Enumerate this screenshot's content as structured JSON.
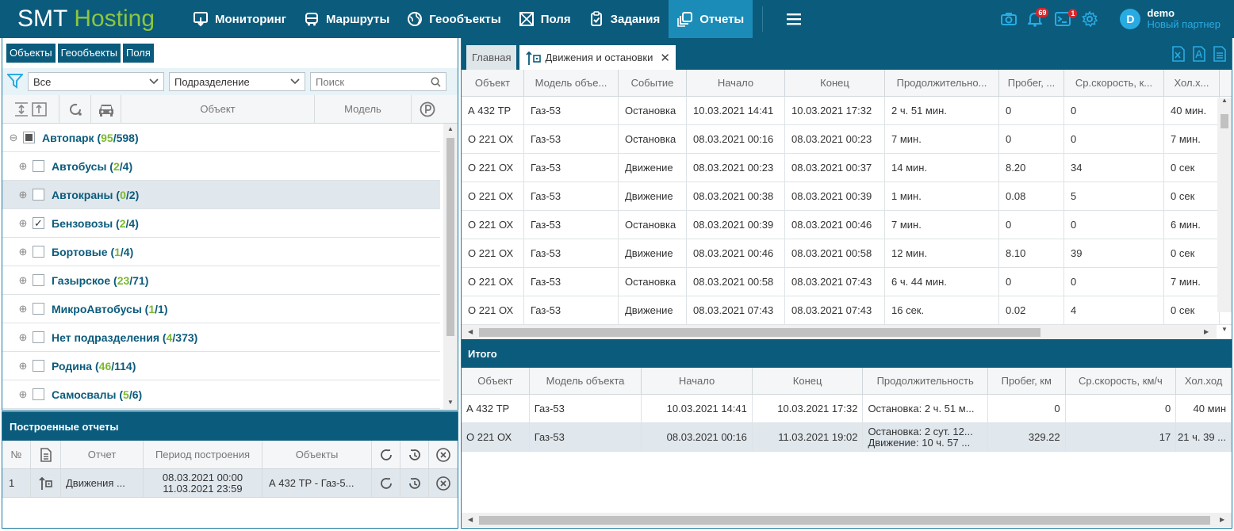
{
  "app": {
    "logo_part1": "SMT",
    "logo_part2": "Hosting"
  },
  "nav": [
    {
      "label": "Мониторинг"
    },
    {
      "label": "Маршруты"
    },
    {
      "label": "Геообъекты"
    },
    {
      "label": "Поля"
    },
    {
      "label": "Задания"
    },
    {
      "label": "Отчеты",
      "active": true
    }
  ],
  "notifications": {
    "alerts_count": "69",
    "messages_count": "1"
  },
  "user": {
    "initial": "D",
    "name": "demo",
    "role": "Новый партнер"
  },
  "left": {
    "tabs": [
      "Объекты",
      "Геообъекты",
      "Поля"
    ],
    "filter_value": "Все",
    "division_value": "Подразделение",
    "search_placeholder": "Поиск",
    "tree_headers": {
      "object": "Объект",
      "model": "Модель"
    },
    "tree": [
      {
        "label": "Автопарк",
        "on": "95",
        "total": "/598",
        "level": 0,
        "check": "partial"
      },
      {
        "label": "Автобусы",
        "on": "2",
        "total": "/4",
        "level": 1,
        "check": "none"
      },
      {
        "label": "Автокраны",
        "on": "0",
        "total": "/2",
        "level": 1,
        "check": "none",
        "selected": true
      },
      {
        "label": "Бензовозы",
        "on": "2",
        "total": "/4",
        "level": 1,
        "check": "checked"
      },
      {
        "label": "Бортовые",
        "on": "1",
        "total": "/4",
        "level": 1,
        "check": "none"
      },
      {
        "label": "Газырское",
        "on": "23",
        "total": "/71",
        "level": 1,
        "check": "none"
      },
      {
        "label": "МикроАвтобусы",
        "on": "1",
        "total": "/1",
        "level": 1,
        "check": "none"
      },
      {
        "label": "Нет подразделения",
        "on": "4",
        "total": "/373",
        "level": 1,
        "check": "none"
      },
      {
        "label": "Родина",
        "on": "46",
        "total": "/114",
        "level": 1,
        "check": "none"
      },
      {
        "label": "Самосвалы",
        "on": "5",
        "total": "/6",
        "level": 1,
        "check": "none"
      }
    ]
  },
  "reports": {
    "title": "Построенные отчеты",
    "headers": {
      "num": "№",
      "report": "Отчет",
      "period": "Период построения",
      "objects": "Объекты"
    },
    "rows": [
      {
        "num": "1",
        "report": "Движения ...",
        "period_from": "08.03.2021 00:00",
        "period_to": "11.03.2021 23:59",
        "objects": "А 432 ТР - Газ-5..."
      }
    ]
  },
  "right": {
    "tab_home": "Главная",
    "tab_current": "Движения и остановки",
    "headers": [
      "Объект",
      "Модель объе...",
      "Событие",
      "Начало",
      "Конец",
      "Продолжительно...",
      "Пробег, ...",
      "Ср.скорость, к...",
      "Хол.х..."
    ],
    "rows": [
      [
        "А 432 ТР",
        "Газ-53",
        "Остановка",
        "10.03.2021 14:41",
        "10.03.2021 17:32",
        "2 ч. 51 мин.",
        "0",
        "0",
        "40 мин."
      ],
      [
        "О 221 ОХ",
        "Газ-53",
        "Остановка",
        "08.03.2021 00:16",
        "08.03.2021 00:23",
        "7 мин.",
        "0",
        "0",
        "7 мин."
      ],
      [
        "О 221 ОХ",
        "Газ-53",
        "Движение",
        "08.03.2021 00:23",
        "08.03.2021 00:37",
        "14 мин.",
        "8.20",
        "34",
        "0 сек"
      ],
      [
        "О 221 ОХ",
        "Газ-53",
        "Движение",
        "08.03.2021 00:38",
        "08.03.2021 00:39",
        "1 мин.",
        "0.08",
        "5",
        "0 сек"
      ],
      [
        "О 221 ОХ",
        "Газ-53",
        "Остановка",
        "08.03.2021 00:39",
        "08.03.2021 00:46",
        "7 мин.",
        "0",
        "0",
        "6 мин."
      ],
      [
        "О 221 ОХ",
        "Газ-53",
        "Движение",
        "08.03.2021 00:46",
        "08.03.2021 00:58",
        "12 мин.",
        "8.10",
        "39",
        "0 сек"
      ],
      [
        "О 221 ОХ",
        "Газ-53",
        "Остановка",
        "08.03.2021 00:58",
        "08.03.2021 07:43",
        "6 ч. 44 мин.",
        "0",
        "0",
        "7 мин."
      ],
      [
        "О 221 ОХ",
        "Газ-53",
        "Движение",
        "08.03.2021 07:43",
        "08.03.2021 07:43",
        "16 сек.",
        "0.02",
        "4",
        "0 сек"
      ]
    ],
    "summary_title": "Итого",
    "summary_headers": [
      "Объект",
      "Модель объекта",
      "Начало",
      "Конец",
      "Продолжительность",
      "Пробег, км",
      "Ср.скорость, км/ч",
      "Хол.ход"
    ],
    "summary_rows": [
      {
        "object": "А 432 ТР",
        "model": "Газ-53",
        "start": "10.03.2021 14:41",
        "end": "10.03.2021 17:32",
        "dur1": "Остановка: 2 ч. 51 м...",
        "dur2": "",
        "mileage": "0",
        "speed": "0",
        "idle": "40 мин"
      },
      {
        "object": "О 221 ОХ",
        "model": "Газ-53",
        "start": "08.03.2021 00:16",
        "end": "11.03.2021 19:02",
        "dur1": "Остановка: 2 сут. 12...",
        "dur2": "Движение: 10 ч. 57 ...",
        "mileage": "329.22",
        "speed": "17",
        "idle": "21 ч. 39 ..."
      }
    ]
  }
}
